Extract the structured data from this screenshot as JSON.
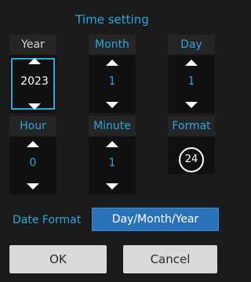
{
  "dialog": {
    "title": "Time setting"
  },
  "year": {
    "label": "Year",
    "value": "2023"
  },
  "month": {
    "label": "Month",
    "value": "1"
  },
  "day": {
    "label": "Day",
    "value": "1"
  },
  "hour": {
    "label": "Hour",
    "value": "0"
  },
  "minute": {
    "label": "Minute",
    "value": "1"
  },
  "format": {
    "label": "Format",
    "icon": "24-hour-clock-icon",
    "icon_text": "24"
  },
  "date_format": {
    "label": "Date Format",
    "value": "Day/Month/Year"
  },
  "buttons": {
    "ok": "OK",
    "cancel": "Cancel"
  },
  "colors": {
    "accent": "#2fa6dc",
    "selected_button": "#2a72b8",
    "button_bg": "#d9d9d9"
  }
}
